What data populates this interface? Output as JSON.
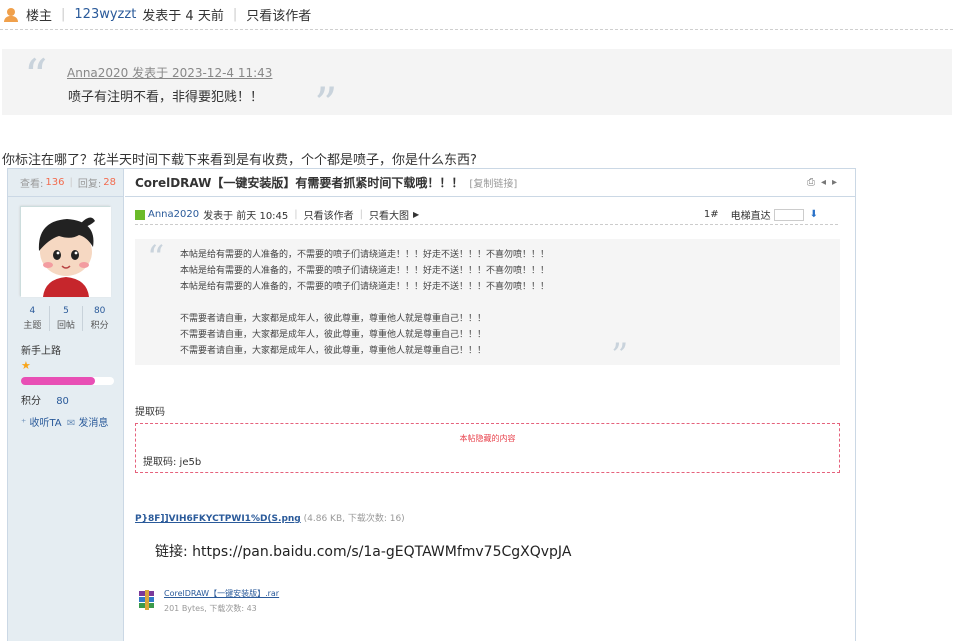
{
  "header": {
    "role": "楼主",
    "author": "123wyzzt",
    "posted": "发表于 4 天前",
    "only_author": "只看该作者"
  },
  "quote": {
    "author_line": "Anna2020 发表于 2023-12-4 11:43",
    "text": "喷子有注明不看，非得要犯贱！！"
  },
  "reply_text": "你标注在哪了？花半天时间下载下来看到是有收费，个个都是喷子，你是什么东西?",
  "screenshot": {
    "sidebar": {
      "views_label": "查看:",
      "views": "136",
      "replies_label": "回复:",
      "replies": "28",
      "stats": [
        {
          "value": "4",
          "label": "主题"
        },
        {
          "value": "5",
          "label": "回帖"
        },
        {
          "value": "80",
          "label": "积分"
        }
      ],
      "rank": "新手上路",
      "progress": 0.8,
      "points_label": "积分",
      "points": "80",
      "follow": "收听TA",
      "message": "发消息"
    },
    "post": {
      "title": "CorelDRAW【一键安装版】有需要者抓紧时间下载哦！！！",
      "copy_link": "[复制链接]",
      "author": "Anna2020",
      "posted": "发表于 前天 10:45",
      "only_author": "只看该作者",
      "only_big": "只看大图",
      "floor": "1#",
      "elevator": "电梯直达",
      "quote_lines_a": [
        "本帖是给有需要的人准备的，不需要的喷子们请绕道走！！！好走不送！！！不喜勿喷！！！",
        "本帖是给有需要的人准备的，不需要的喷子们请绕道走！！！好走不送！！！不喜勿喷！！！",
        "本帖是给有需要的人准备的，不需要的喷子们请绕道走！！！好走不送！！！不喜勿喷！！！"
      ],
      "quote_lines_b": [
        "不需要者请自重，大家都是成年人，彼此尊重，尊重他人就是尊重自己！！！",
        "不需要者请自重，大家都是成年人，彼此尊重，尊重他人就是尊重自己！！！",
        "不需要者请自重，大家都是成年人，彼此尊重，尊重他人就是尊重自己！！！"
      ],
      "code_label": "提取码",
      "hidden_title": "本帖隐藏的内容",
      "hidden_code": "提取码: je5b",
      "attachment1_name": "P}8F]]VIH6FKYCTPWI1%D(S.png",
      "attachment1_meta": "(4.86 KB, 下载次数: 16)",
      "baidu_link": "链接: https://pan.baidu.com/s/1a-gEQTAWMfmv75CgXQvpJA",
      "attachment2_name": "CorelDRAW【一键安装版】.rar",
      "attachment2_meta": "201 Bytes, 下载次数: 43"
    }
  },
  "colors": {
    "accent": "#2a5a9a",
    "red": "#f26c4f",
    "progress": "#e84fb5"
  }
}
